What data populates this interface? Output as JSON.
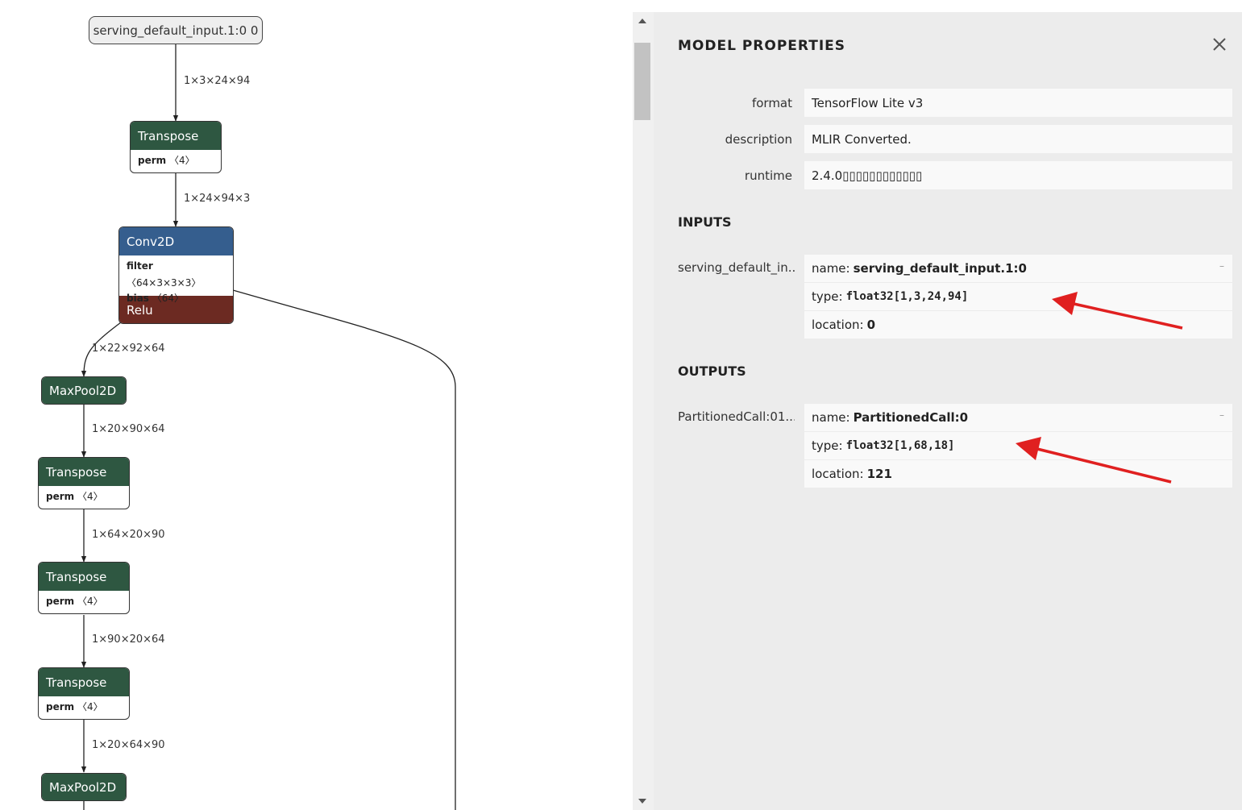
{
  "graph": {
    "input_node": "serving_default_input.1:0 0",
    "edges": [
      "1×3×24×94",
      "1×24×94×3",
      "1×22×92×64",
      "1×20×90×64",
      "1×64×20×90",
      "1×90×20×64",
      "1×20×64×90"
    ],
    "nodes": [
      {
        "op": "Transpose",
        "attrs": [
          {
            "key": "perm",
            "value": "〈4〉"
          }
        ]
      },
      {
        "op": "Conv2D",
        "attrs": [
          {
            "key": "filter",
            "value": "〈64×3×3×3〉"
          },
          {
            "key": "bias",
            "value": "〈64〉"
          }
        ],
        "fused": "Relu"
      },
      {
        "op": "MaxPool2D",
        "attrs": []
      },
      {
        "op": "Transpose",
        "attrs": [
          {
            "key": "perm",
            "value": "〈4〉"
          }
        ]
      },
      {
        "op": "Transpose",
        "attrs": [
          {
            "key": "perm",
            "value": "〈4〉"
          }
        ]
      },
      {
        "op": "Transpose",
        "attrs": [
          {
            "key": "perm",
            "value": "〈4〉"
          }
        ]
      },
      {
        "op": "MaxPool2D",
        "attrs": []
      }
    ],
    "colors": {
      "layer": "#2e5741",
      "conv": "#355e8e",
      "activation": "#6c2a22"
    }
  },
  "sidebar": {
    "title": "MODEL PROPERTIES",
    "close_icon": "close-icon",
    "properties": [
      {
        "label": "format",
        "value": "TensorFlow Lite v3"
      },
      {
        "label": "description",
        "value": "MLIR Converted."
      },
      {
        "label": "runtime",
        "value": "2.4.0▯▯▯▯▯▯▯▯▯▯▯▯"
      }
    ],
    "inputs": {
      "title": "INPUTS",
      "items": [
        {
          "label": "serving_default_in...",
          "name_key": "name:",
          "name": "serving_default_input.1:0",
          "type_key": "type:",
          "type": "float32[1,3,24,94]",
          "location_key": "location:",
          "location": "0",
          "expander": "–"
        }
      ]
    },
    "outputs": {
      "title": "OUTPUTS",
      "items": [
        {
          "label": "PartitionedCall:01...",
          "name_key": "name:",
          "name": "PartitionedCall:0",
          "type_key": "type:",
          "type": "float32[1,68,18]",
          "location_key": "location:",
          "location": "121",
          "expander": "–"
        }
      ]
    }
  },
  "annotation_color": "#e02020"
}
